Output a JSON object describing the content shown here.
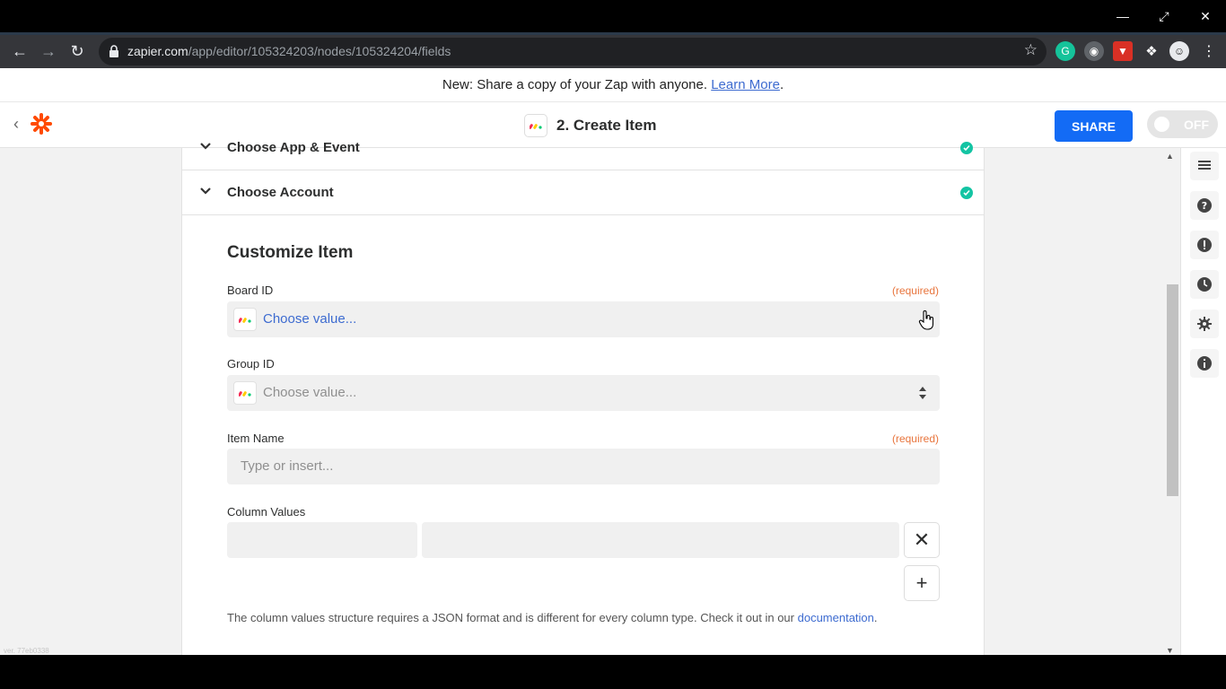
{
  "browser": {
    "url_host": "zapier.com",
    "url_path": "/app/editor/105324203/nodes/105324204/fields",
    "window_controls": [
      "minimize",
      "restore",
      "close"
    ]
  },
  "banner": {
    "text": "New: Share a copy of your Zap with anyone.",
    "link": "Learn More",
    "period": "."
  },
  "appbar": {
    "step_title": "2. Create Item",
    "share_label": "SHARE",
    "toggle_label": "OFF"
  },
  "sections": {
    "choose_app_label": "Choose App & Event",
    "choose_account_label": "Choose Account"
  },
  "form": {
    "title": "Customize Item",
    "board_id": {
      "label": "Board ID",
      "required": "(required)",
      "value": "Choose value..."
    },
    "group_id": {
      "label": "Group ID",
      "value": "Choose value..."
    },
    "item_name": {
      "label": "Item Name",
      "required": "(required)",
      "placeholder": "Type or insert..."
    },
    "column_values": {
      "label": "Column Values",
      "remove_label": "✕",
      "add_label": "+"
    },
    "help_text": "The column values structure requires a JSON format and is different for every column type. Check it out in our ",
    "help_link": "documentation",
    "help_end": "."
  },
  "footer": {
    "version": "ver. 77eb0338"
  },
  "colors": {
    "share_blue": "#136bf5",
    "zapier_orange": "#ff4a00",
    "success_teal": "#13c4a3",
    "required_orange": "#e8753d"
  }
}
